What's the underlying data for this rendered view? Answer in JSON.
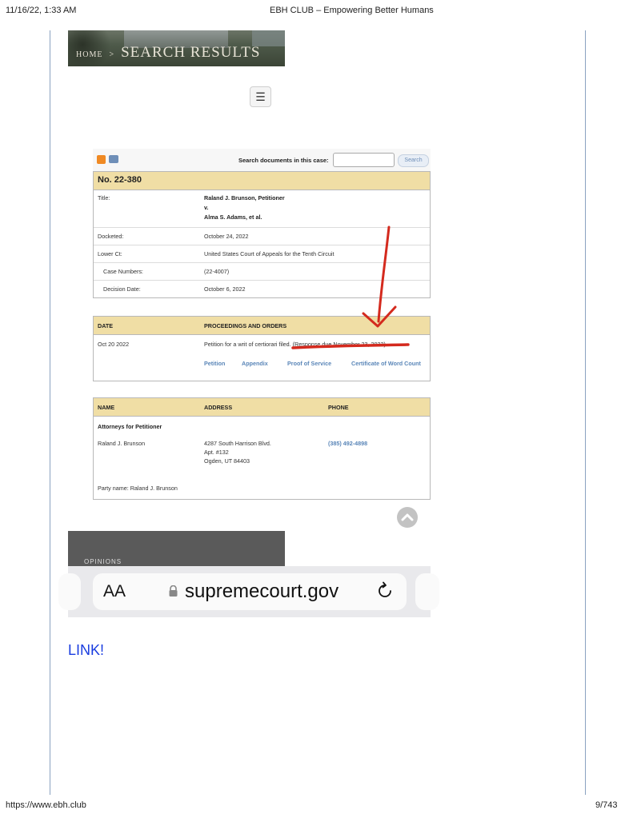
{
  "print_header": {
    "datetime": "11/16/22, 1:33 AM",
    "site_title": "EBH CLUB – Empowering Better Humans"
  },
  "print_footer": {
    "url": "https://www.ebh.club",
    "page": "9/743"
  },
  "banner": {
    "home": "Home",
    "separator": ">",
    "current": "Search Results"
  },
  "menu_icon": "hamburger-icon",
  "docket": {
    "search_label": "Search documents in this case:",
    "search_button": "Search",
    "case_number": "No. 22-380",
    "info": [
      {
        "key": "Title:",
        "value_lines": [
          "Raland J. Brunson, Petitioner",
          "v.",
          "Alma S. Adams, et al."
        ]
      },
      {
        "key": "Docketed:",
        "value": "October 24, 2022"
      },
      {
        "key": "Lower Ct:",
        "value": "United States Court of Appeals for the Tenth Circuit"
      },
      {
        "key": "Case Numbers:",
        "value": "(22-4007)"
      },
      {
        "key": "Decision Date:",
        "value": "October 6, 2022"
      }
    ],
    "proceedings": {
      "headers": [
        "DATE",
        "PROCEEDINGS AND ORDERS"
      ],
      "entries": [
        {
          "date": "Oct 20 2022",
          "text": "Petition for a writ of certiorari filed. (Response due November 23, 2022)",
          "links": [
            "Petition",
            "Appendix",
            "Proof of Service",
            "Certificate of Word Count"
          ]
        }
      ]
    },
    "contacts": {
      "headers": [
        "NAME",
        "ADDRESS",
        "PHONE"
      ],
      "section": "Attorneys for Petitioner",
      "name": "Raland J. Brunson",
      "address_lines": [
        "4287 South Harrison Blvd.",
        "Apt. #132",
        "Ogden, UT 84403"
      ],
      "phone": "(385) 492-4898",
      "party": "Party name: Raland J. Brunson"
    }
  },
  "opinions_label": "OPINIONS",
  "safari": {
    "text_size": "AA",
    "domain": "supremecourt.gov"
  },
  "link_text": "LINK!",
  "annotation_color": "#d42a1e"
}
